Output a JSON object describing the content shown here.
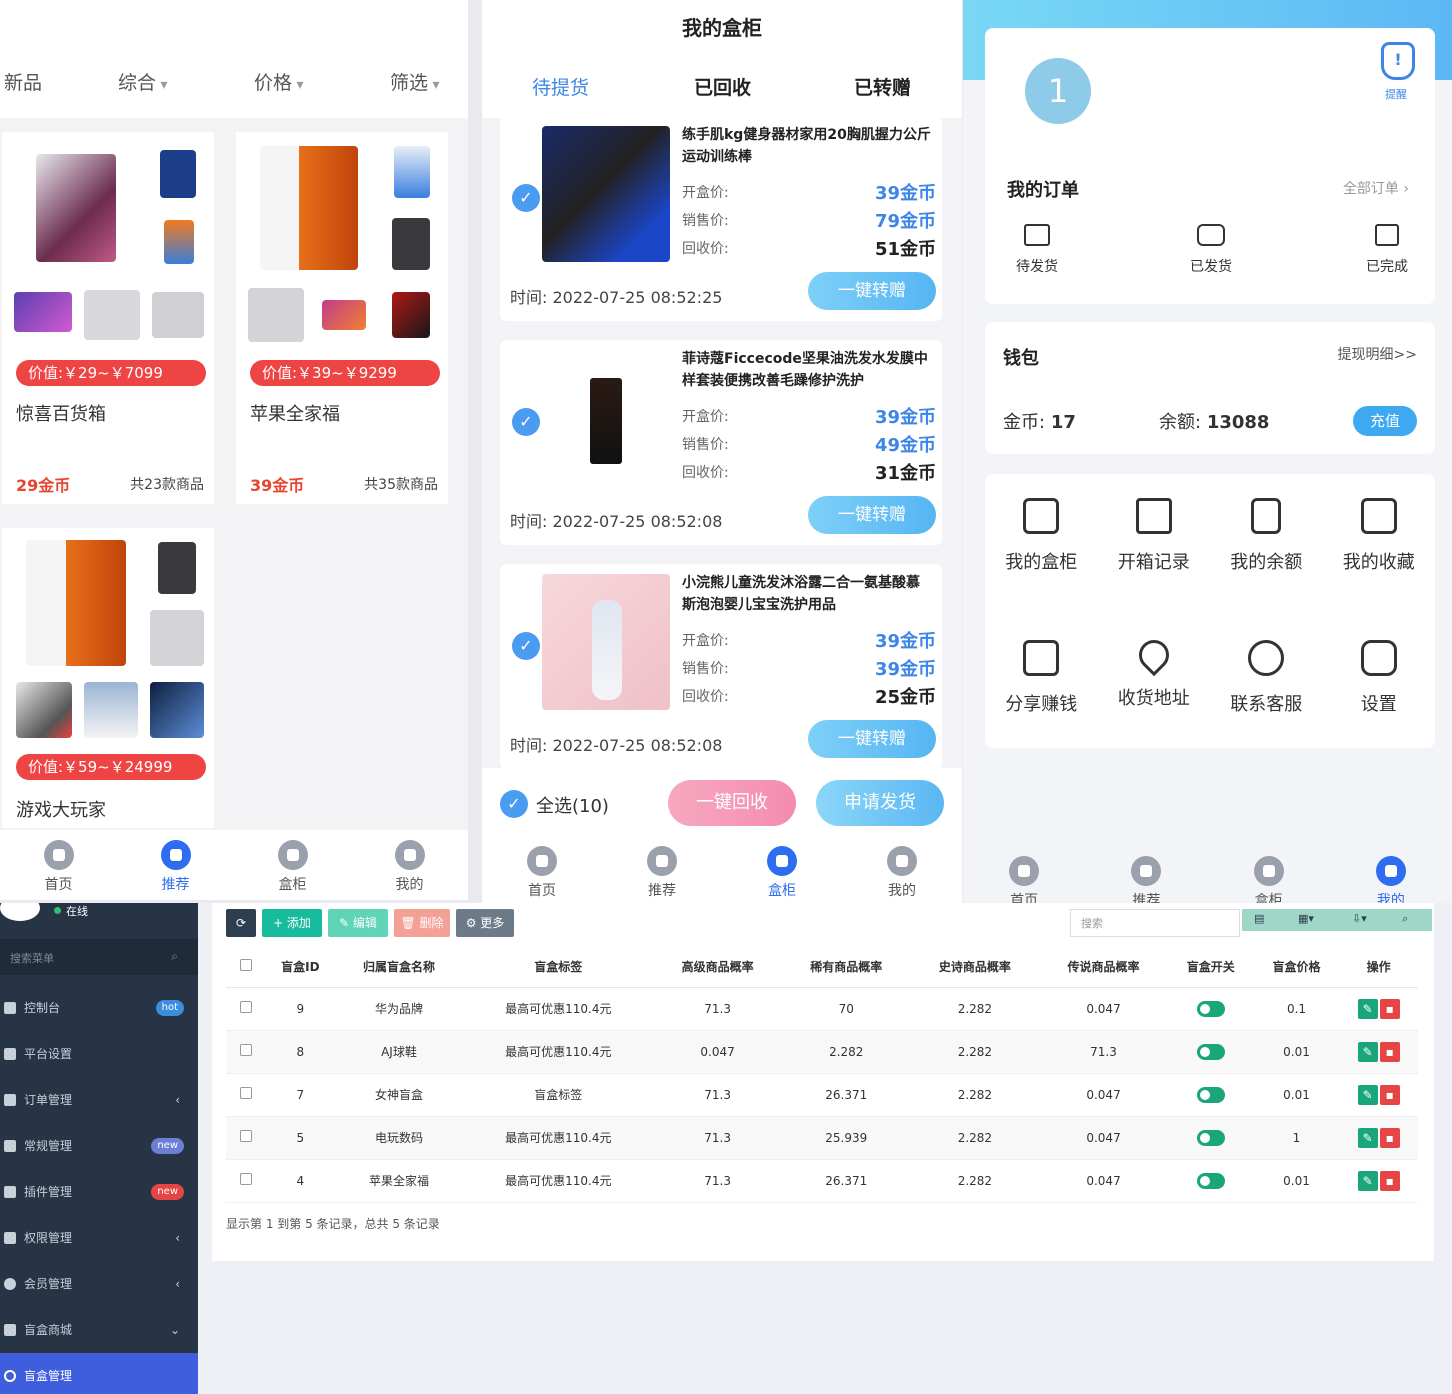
{
  "mall": {
    "filters": [
      "新品",
      "综合",
      "价格",
      "筛选"
    ],
    "products": [
      {
        "price_range": "价值:￥29~￥7099",
        "name": "惊喜百货箱",
        "coins": "29金币",
        "count": "共23款商品"
      },
      {
        "price_range": "价值:￥39~￥9299",
        "name": "苹果全家福",
        "coins": "39金币",
        "count": "共35款商品"
      },
      {
        "price_range": "价值:￥59~￥24999",
        "name": "游戏大玩家"
      }
    ],
    "tabbar": [
      "首页",
      "推荐",
      "盒柜",
      "我的"
    ],
    "active_tab": 1
  },
  "cabinet": {
    "title": "我的盒柜",
    "tabs": [
      "待提货",
      "已回收",
      "已转赠"
    ],
    "labels": {
      "open": "开盒价:",
      "sell": "销售价:",
      "recycle": "回收价:",
      "time": "时间:",
      "transfer_btn": "一键转赠"
    },
    "orders": [
      {
        "name": "练手肌kg健身器材家用20胸肌握力公斤运动训练棒",
        "open": "39金币",
        "sell": "79金币",
        "recycle": "51金币",
        "time": "2022-07-25 08:52:25"
      },
      {
        "name": "菲诗蔻Ficcecode坚果油洗发水发膜中样套装便携改善毛躁修护洗护",
        "open": "39金币",
        "sell": "49金币",
        "recycle": "31金币",
        "time": "2022-07-25 08:52:08"
      },
      {
        "name": "小浣熊儿童洗发沐浴露二合一氨基酸慕斯泡泡婴儿宝宝洗护用品",
        "open": "39金币",
        "sell": "39金币",
        "recycle": "25金币",
        "time": "2022-07-25 08:52:08"
      }
    ],
    "select_all": "全选(10)",
    "recycle_btn": "一键回收",
    "ship_btn": "申请发货",
    "tabbar": [
      "首页",
      "推荐",
      "盒柜",
      "我的"
    ],
    "active_tab": 2
  },
  "mine": {
    "avatar_num": "1",
    "notice": "提醒",
    "orders_title": "我的订单",
    "all_orders": "全部订单",
    "order_states": [
      "待发货",
      "已发货",
      "已完成"
    ],
    "wallet_title": "钱包",
    "withdraw": "提现明细>>",
    "coins_label": "金币:",
    "coins": "17",
    "balance_label": "余额:",
    "balance": "13088",
    "recharge": "充值",
    "grid": [
      "我的盒柜",
      "开箱记录",
      "我的余额",
      "我的收藏",
      "分享赚钱",
      "收货地址",
      "联系客服",
      "设置"
    ],
    "tabbar": [
      "首页",
      "推荐",
      "盒柜",
      "我的"
    ],
    "active_tab": 3
  },
  "admin": {
    "status": "在线",
    "search_placeholder": "搜索菜单",
    "menu": [
      {
        "label": "控制台",
        "badge": "hot"
      },
      {
        "label": "平台设置"
      },
      {
        "label": "订单管理",
        "arrow": "‹"
      },
      {
        "label": "常规管理",
        "badge": "new"
      },
      {
        "label": "插件管理",
        "badge": "new"
      },
      {
        "label": "权限管理",
        "arrow": "‹"
      },
      {
        "label": "会员管理",
        "arrow": "‹"
      },
      {
        "label": "盲盒商城",
        "arrow": "⌄"
      },
      {
        "label": "盲盒管理"
      }
    ],
    "toolbar": {
      "add": "+ 添加",
      "edit": "✎ 编辑",
      "del": "🗑 删除",
      "more": "⚙ 更多",
      "search": "搜索"
    },
    "columns": [
      "盲盒ID",
      "归属盲盒名称",
      "盲盒标签",
      "高级商品概率",
      "稀有商品概率",
      "史诗商品概率",
      "传说商品概率",
      "盲盒开关",
      "盲盒价格",
      "操作"
    ],
    "rows": [
      [
        "9",
        "华为品牌",
        "最高可优惠110.4元",
        "71.3",
        "70",
        "2.282",
        "0.047",
        "0.1"
      ],
      [
        "8",
        "AJ球鞋",
        "最高可优惠110.4元",
        "0.047",
        "2.282",
        "2.282",
        "71.3",
        "0.01"
      ],
      [
        "7",
        "女神盲盒",
        "盲盒标签",
        "71.3",
        "26.371",
        "2.282",
        "0.047",
        "0.01"
      ],
      [
        "5",
        "电玩数码",
        "最高可优惠110.4元",
        "71.3",
        "25.939",
        "2.282",
        "0.047",
        "1"
      ],
      [
        "4",
        "苹果全家福",
        "最高可优惠110.4元",
        "71.3",
        "26.371",
        "2.282",
        "0.047",
        "0.01"
      ]
    ],
    "footer": "显示第 1 到第 5 条记录，总共 5 条记录"
  },
  "colors": {
    "primary": "#2f6df0",
    "price_red": "#ee4444",
    "sidebar": "#263445",
    "toggle_green": "#1aa67a"
  }
}
